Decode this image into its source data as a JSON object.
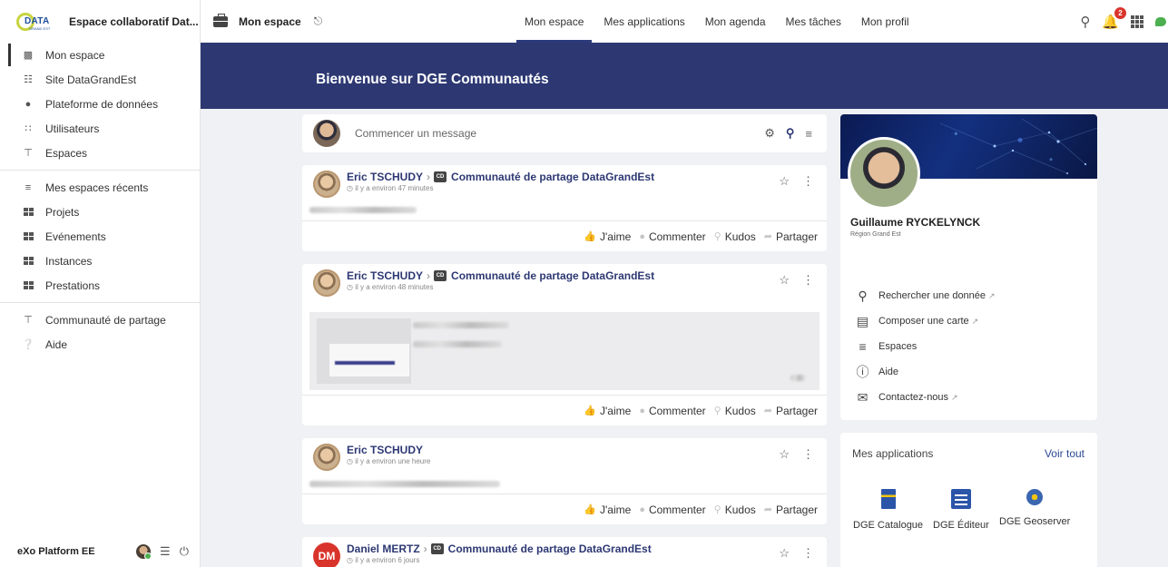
{
  "sidebar": {
    "brand_title": "Espace collaboratif Dat...",
    "logo_word": "DATA",
    "logo_sub": "GRAND EST",
    "items": [
      {
        "label": "Mon espace",
        "icon": "briefcase-icon"
      },
      {
        "label": "Site DataGrandEst",
        "icon": "globe-icon"
      },
      {
        "label": "Plateforme de données",
        "icon": "group-icon"
      },
      {
        "label": "Utilisateurs",
        "icon": "users-icon"
      },
      {
        "label": "Espaces",
        "icon": "spaces-icon"
      }
    ],
    "items2": [
      {
        "label": "Mes espaces récents",
        "icon": "layers-icon"
      },
      {
        "label": "Projets",
        "icon": "grid-icon"
      },
      {
        "label": "Evénements",
        "icon": "grid-icon"
      },
      {
        "label": "Instances",
        "icon": "grid-icon"
      },
      {
        "label": "Prestations",
        "icon": "grid-icon"
      }
    ],
    "items3": [
      {
        "label": "Communauté de partage",
        "icon": "spaces-icon"
      },
      {
        "label": "Aide",
        "icon": "help-icon"
      }
    ],
    "footer_name": "eXo Platform EE"
  },
  "topbar": {
    "space_label": "Mon espace",
    "tabs": [
      "Mon espace",
      "Mes applications",
      "Mon agenda",
      "Mes tâches",
      "Mon profil"
    ],
    "notification_count": "2"
  },
  "banner": {
    "title": "Bienvenue sur DGE Communautés"
  },
  "composer": {
    "placeholder": "Commencer un message"
  },
  "posts": [
    {
      "author": "Eric TSCHUDY",
      "space_initials": "CD",
      "space": "Communauté de partage DataGrandEst",
      "time": "il y a environ 47 minutes"
    },
    {
      "author": "Eric TSCHUDY",
      "space_initials": "CD",
      "space": "Communauté de partage DataGrandEst",
      "time": "il y a environ 48 minutes"
    },
    {
      "author": "Eric TSCHUDY",
      "space_initials": "",
      "space": "",
      "time": "il y a environ une heure"
    },
    {
      "author": "Daniel MERTZ",
      "initials": "DM",
      "space_initials": "CD",
      "space": "Communauté de partage DataGrandEst",
      "time": "il y a environ 6 jours"
    }
  ],
  "post_actions": {
    "like": "J'aime",
    "comment": "Commenter",
    "kudos": "Kudos",
    "share": "Partager"
  },
  "profile": {
    "name": "Guillaume RYCKELYNCK",
    "org": "Région Grand Est",
    "links": [
      {
        "label": "Rechercher une donnée",
        "icon": "search-icon",
        "external": true
      },
      {
        "label": "Composer une carte",
        "icon": "map-icon",
        "external": true
      },
      {
        "label": "Espaces",
        "icon": "layers-icon",
        "external": false
      },
      {
        "label": "Aide",
        "icon": "help-circle-icon",
        "external": false
      },
      {
        "label": "Contactez-nous",
        "icon": "contact-icon",
        "external": true
      }
    ]
  },
  "apps": {
    "title": "Mes applications",
    "see_all": "Voir tout",
    "items": [
      "DGE Catalogue",
      "DGE Éditeur",
      "DGE Geoserver"
    ]
  }
}
